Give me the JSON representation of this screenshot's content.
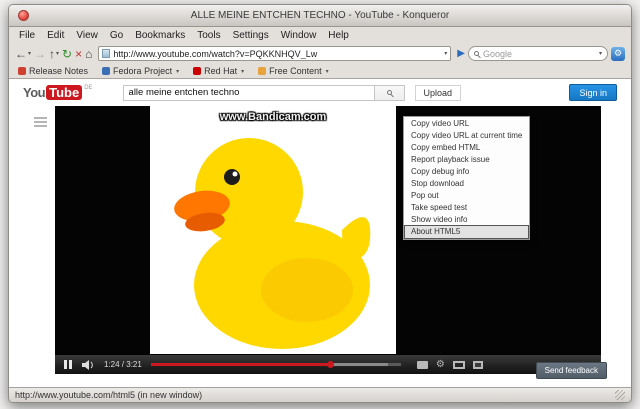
{
  "window": {
    "title": "ALLE MEINE ENTCHEN TECHNO - YouTube - Konqueror"
  },
  "menubar": {
    "items": [
      "File",
      "Edit",
      "View",
      "Go",
      "Bookmarks",
      "Tools",
      "Settings",
      "Window",
      "Help"
    ]
  },
  "toolbar": {
    "url": "http://www.youtube.com/watch?v=PQKKNHQV_Lw",
    "search_placeholder": "Google"
  },
  "icons": {
    "back": "←",
    "forward": "→",
    "up": "↑",
    "reload": "↻",
    "stop": "×",
    "home": "⌂",
    "caret": "▾",
    "go": "▶",
    "gear": "⚙"
  },
  "bookmarks": {
    "items": [
      "Release Notes",
      "Fedora Project",
      "Red Hat",
      "Free Content"
    ]
  },
  "youtube": {
    "logo_you": "You",
    "logo_tube": "Tube",
    "region": "DE",
    "search_value": "alle meine entchen techno",
    "upload_label": "Upload",
    "signin_label": "Sign in"
  },
  "video": {
    "watermark": "www.Bandicam.com",
    "time_display": "1:24 / 3:21",
    "played_percent": 72,
    "buffered_percent": 95
  },
  "context_menu": {
    "items": [
      "Copy video URL",
      "Copy video URL at current time",
      "Copy embed HTML",
      "Report playback issue",
      "Copy debug info",
      "Stop download",
      "Pop out",
      "Take speed test",
      "Show video info",
      "About HTML5"
    ],
    "highlighted": "About HTML5"
  },
  "feedback_label": "Send feedback",
  "statusbar": {
    "text": "http://www.youtube.com/html5 (in new window)"
  },
  "colors": {
    "youtube_red": "#cc181e",
    "signin_blue": "#1678c2",
    "feedback_slate": "#5d6974",
    "progress_red": "#cc181e"
  }
}
